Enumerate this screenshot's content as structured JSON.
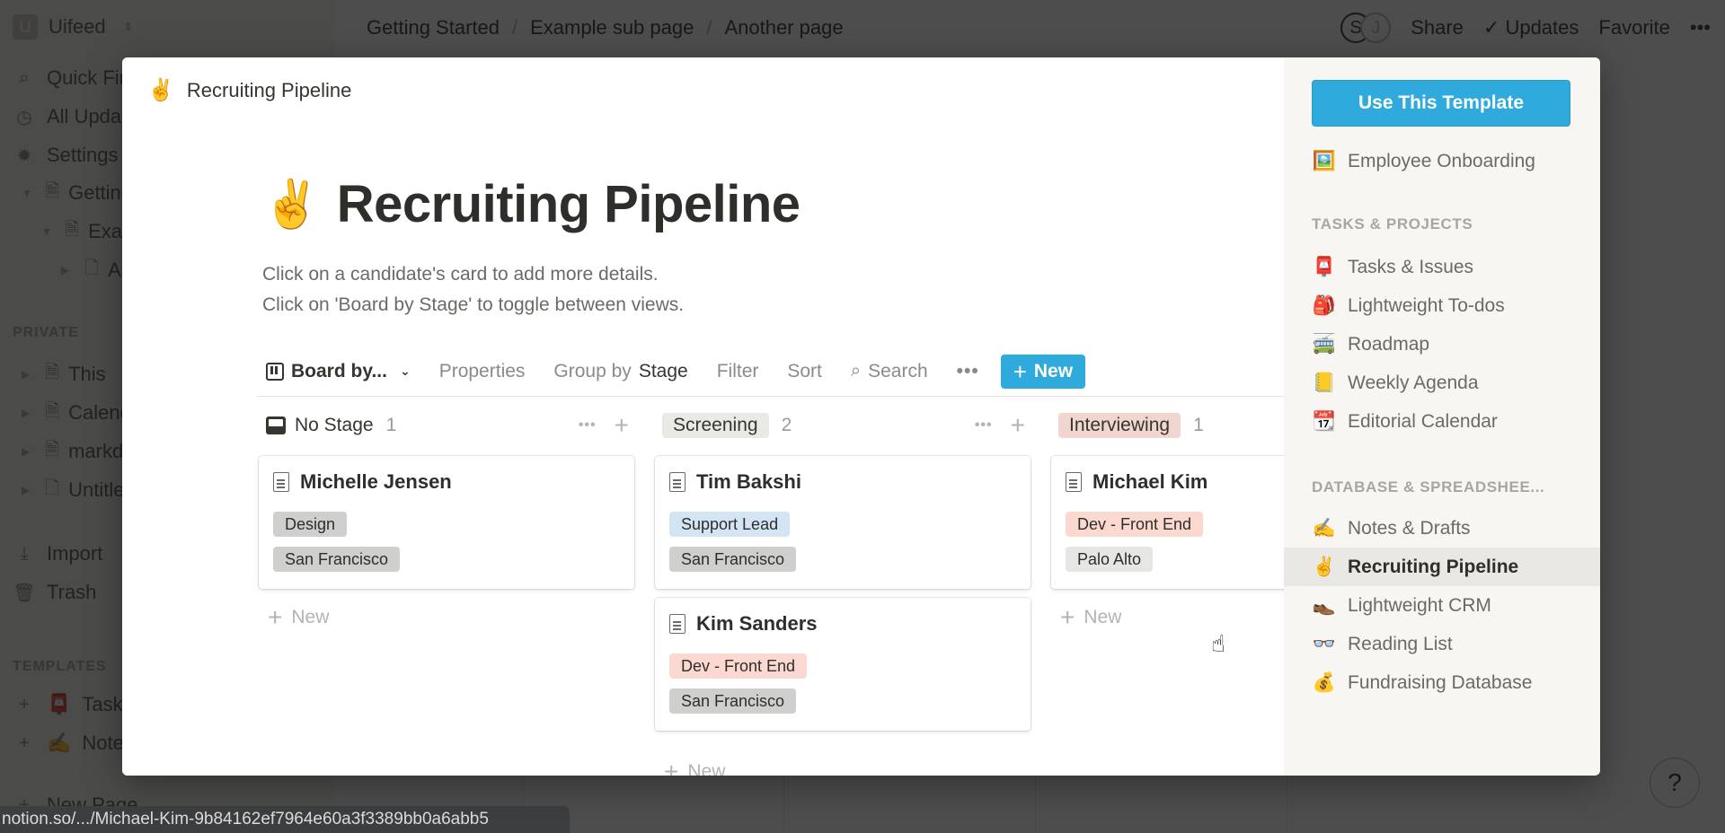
{
  "workspace": {
    "initial": "U",
    "name": "Uifeed"
  },
  "left_sidebar": {
    "nav": [
      {
        "icon": "search-icon",
        "glyph": "⌕",
        "label": "Quick Find"
      },
      {
        "icon": "clock-icon",
        "glyph": "◷",
        "label": "All Updates"
      },
      {
        "icon": "gear-icon",
        "glyph": "✹",
        "label": "Settings & Members"
      }
    ],
    "tree": [
      {
        "label": "Getting Started"
      },
      {
        "label": "Example sub page"
      },
      {
        "label": "Another page"
      }
    ],
    "private_header": "PRIVATE",
    "private_pages": [
      {
        "label": "This"
      },
      {
        "label": "Calendar"
      },
      {
        "label": "markdown"
      },
      {
        "label": "Untitled"
      }
    ],
    "import_label": "Import",
    "trash_label": "Trash",
    "templates_header": "TEMPLATES",
    "templates": [
      {
        "emoji": "📮",
        "label": "Tasks"
      },
      {
        "emoji": "✍️",
        "label": "Notes"
      }
    ],
    "new_page_label": "New Page"
  },
  "topbar": {
    "breadcrumbs": [
      "Getting Started",
      "Example sub page",
      "Another page"
    ],
    "avatars": [
      "S",
      "J"
    ],
    "share_label": "Share",
    "updates_label": "Updates",
    "favorite_label": "Favorite",
    "more_label": "•••"
  },
  "modal": {
    "header": {
      "emoji": "✌️",
      "title": "Recruiting Pipeline"
    },
    "page": {
      "emoji": "✌️",
      "title": "Recruiting Pipeline",
      "description": [
        "Click on a candidate's card to add more details.",
        "Click on 'Board by Stage' to toggle between views."
      ]
    },
    "toolbar": {
      "view_label": "Board by...",
      "properties_label": "Properties",
      "group_by_prefix": "Group by",
      "group_by_value": "Stage",
      "filter_label": "Filter",
      "sort_label": "Sort",
      "search_label": "Search",
      "more_label": "•••",
      "new_label": "New"
    },
    "board": {
      "add_new_label": "New",
      "columns": [
        {
          "name": "No Stage",
          "count": "1",
          "pill_color": "",
          "cards": [
            {
              "name": "Michelle Jensen",
              "tags": [
                {
                  "label": "Design",
                  "color": "#cfcfcd"
                },
                {
                  "label": "San Francisco",
                  "color": "#cfcfcd"
                }
              ]
            }
          ]
        },
        {
          "name": "Screening",
          "count": "2",
          "pill_color": "#e9e9e6",
          "cards": [
            {
              "name": "Tim Bakshi",
              "tags": [
                {
                  "label": "Support Lead",
                  "color": "#d3e5f5"
                },
                {
                  "label": "San Francisco",
                  "color": "#cfcfcd"
                }
              ]
            },
            {
              "name": "Kim Sanders",
              "tags": [
                {
                  "label": "Dev - Front End",
                  "color": "#fbd9d0"
                },
                {
                  "label": "San Francisco",
                  "color": "#cfcfcd"
                }
              ]
            }
          ]
        },
        {
          "name": "Interviewing",
          "count": "1",
          "pill_color": "#f1d5cf",
          "cards": [
            {
              "name": "Michael Kim",
              "tags": [
                {
                  "label": "Dev - Front End",
                  "color": "#fbd9d0"
                },
                {
                  "label": "Palo Alto",
                  "color": "#e6e6e4"
                }
              ]
            }
          ]
        }
      ]
    },
    "template_list": {
      "use_button": "Use This Template",
      "top_item": {
        "emoji": "🖼️",
        "label": "Employee Onboarding"
      },
      "sections": [
        {
          "title": "TASKS & PROJECTS",
          "items": [
            {
              "emoji": "📮",
              "label": "Tasks & Issues"
            },
            {
              "emoji": "🎒",
              "label": "Lightweight To-dos"
            },
            {
              "emoji": "🚎",
              "label": "Roadmap"
            },
            {
              "emoji": "📒",
              "label": "Weekly Agenda"
            },
            {
              "emoji": "📆",
              "label": "Editorial Calendar"
            }
          ]
        },
        {
          "title": "DATABASE & SPREADSHEE...",
          "items": [
            {
              "emoji": "✍️",
              "label": "Notes & Drafts"
            },
            {
              "emoji": "✌️",
              "label": "Recruiting Pipeline",
              "active": true
            },
            {
              "emoji": "👞",
              "label": "Lightweight CRM"
            },
            {
              "emoji": "👓",
              "label": "Reading List"
            },
            {
              "emoji": "💰",
              "label": "Fundraising Database"
            }
          ]
        }
      ]
    }
  },
  "status_url": "notion.so/.../Michael-Kim-9b84162ef7964e60a3f3389bb0a6abb5",
  "help_label": "?",
  "colors": {
    "accent": "#2eaadc",
    "overlay": "#0f0f0f",
    "sidebar_bg": "#f7f6f3",
    "active_row": "#e9e8e5"
  }
}
